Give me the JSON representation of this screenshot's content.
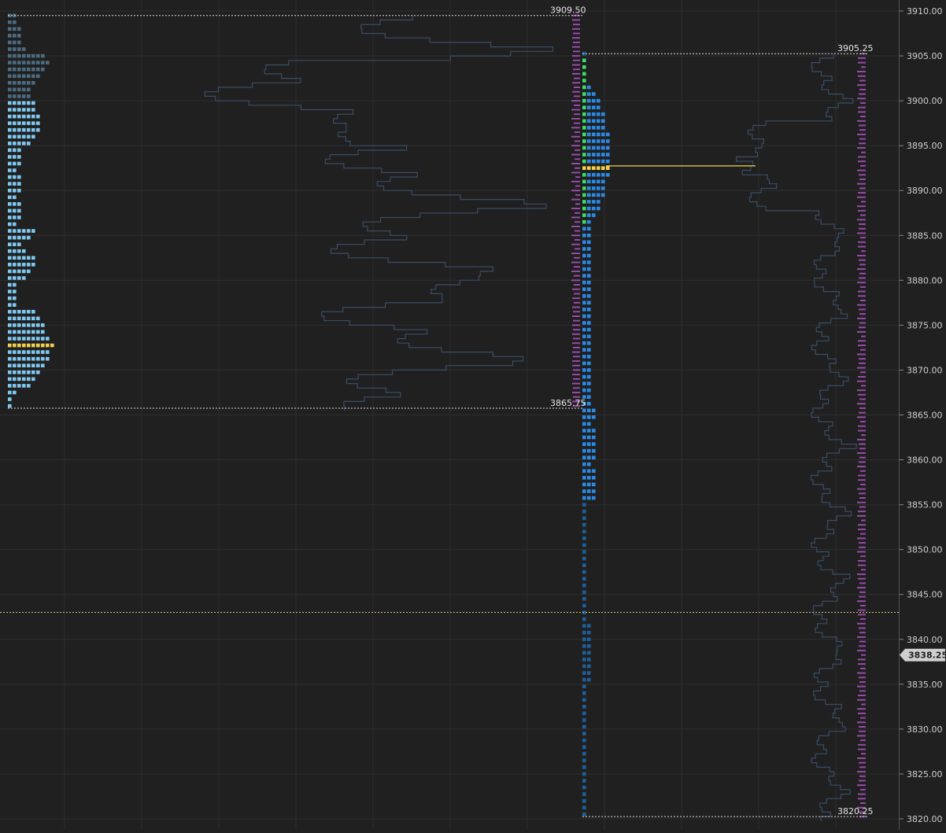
{
  "app": {
    "view": "market-profile"
  },
  "axis": {
    "min": 3820.0,
    "max": 3910.0,
    "ticks": [
      "3910.00",
      "3905.00",
      "3900.00",
      "3895.00",
      "3890.00",
      "3885.00",
      "3880.00",
      "3875.00",
      "3870.00",
      "3865.00",
      "3860.00",
      "3855.00",
      "3850.00",
      "3845.00",
      "3840.00",
      "3835.00",
      "3830.00",
      "3825.00",
      "3820.00"
    ]
  },
  "current_price": {
    "value": 3843.0,
    "badge_label": "3838.25",
    "badge_value": 3838.25
  },
  "labels": {
    "profile1_high": "3909.50",
    "profile1_low": "3865.75",
    "profile2_high": "3905.25",
    "profile2_low": "3820.25"
  },
  "chart_data": {
    "type": "market-profile",
    "profile1": {
      "high": 3909.5,
      "low": 3865.75,
      "poc": 3873.0,
      "value_area_high": 3900.0,
      "value_area_low": 3865.75
    },
    "profile2": {
      "high": 3905.25,
      "low": 3820.25,
      "poc": 3892.75
    }
  },
  "colors": {
    "background": "#202020",
    "grid": "#2e2e2e",
    "tpo_light_blue": "#7fc8f0",
    "tpo_gray_blue": "#4c6b80",
    "tpo_blue": "#2a8ae6",
    "tpo_dark_blue": "#1e5f9a",
    "tpo_green": "#3ddc6a",
    "poc_yellow": "#f2d24a",
    "volume_outline": "#3a4d66",
    "delta_magenta": "#c05ad6",
    "current_line": "#d4c27a"
  }
}
